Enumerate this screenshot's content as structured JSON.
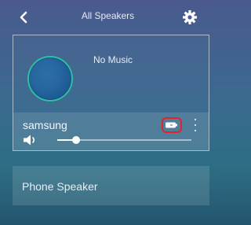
{
  "header": {
    "title": "All Speakers",
    "back_icon": "chevron-left-icon",
    "settings_icon": "gear-icon"
  },
  "now_playing": {
    "status": "No Music",
    "album_art": "album-art"
  },
  "device": {
    "name": "samsung",
    "battery_icon": "battery-icon",
    "more_icon": "more-vertical-icon",
    "volume_icon": "volume-icon",
    "volume_level": 0.14
  },
  "other_speakers": [
    {
      "label": "Phone Speaker"
    }
  ],
  "colors": {
    "highlight": "#e3232b",
    "album_ring": "#2bbfa4",
    "text": "#ffffff"
  }
}
